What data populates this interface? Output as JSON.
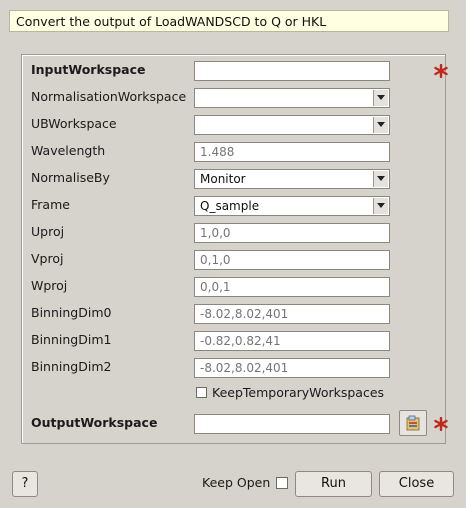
{
  "description": "Convert the output of LoadWANDSCD to Q or HKL",
  "properties": [
    {
      "label": "InputWorkspace",
      "value": "",
      "required": true
    },
    {
      "label": "NormalisationWorkspace",
      "value": ""
    },
    {
      "label": "UBWorkspace",
      "value": ""
    },
    {
      "label": "Wavelength",
      "placeholder": "1.488"
    },
    {
      "label": "NormaliseBy",
      "value": "Monitor"
    },
    {
      "label": "Frame",
      "value": "Q_sample"
    },
    {
      "label": "Uproj",
      "placeholder": "1,0,0"
    },
    {
      "label": "Vproj",
      "placeholder": "0,1,0"
    },
    {
      "label": "Wproj",
      "placeholder": "0,0,1"
    },
    {
      "label": "BinningDim0",
      "placeholder": "-8.02,8.02,401"
    },
    {
      "label": "BinningDim1",
      "placeholder": "-0.82,0.82,41"
    },
    {
      "label": "BinningDim2",
      "placeholder": "-8.02,8.02,401"
    },
    {
      "label": "OutputWorkspace",
      "value": "",
      "required": true
    }
  ],
  "keep_temp": {
    "label": "KeepTemporaryWorkspaces",
    "checked": false
  },
  "buttons": {
    "help": "?",
    "keep_open": "Keep Open",
    "run": "Run",
    "close": "Close"
  },
  "colors": {
    "required_star": "#c0281c"
  },
  "icons": {
    "required": "asterisk-icon",
    "browse": "browse-workspace-icon",
    "dropdown": "chevron-down-icon"
  }
}
